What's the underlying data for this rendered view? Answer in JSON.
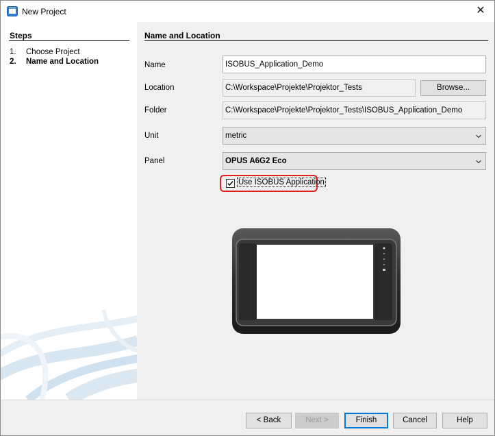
{
  "window": {
    "title": "New Project",
    "close_glyph": "✕"
  },
  "steps": {
    "title": "Steps",
    "items": [
      {
        "num": "1.",
        "label": "Choose Project"
      },
      {
        "num": "2.",
        "label": "Name and Location"
      }
    ]
  },
  "section_title": "Name and Location",
  "form": {
    "name_label": "Name",
    "name_value": "ISOBUS_Application_Demo",
    "location_label": "Location",
    "location_value": "C:\\Workspace\\Projekte\\Projektor_Tests",
    "browse_label": "Browse...",
    "folder_label": "Folder",
    "folder_value": "C:\\Workspace\\Projekte\\Projektor_Tests\\ISOBUS_Application_Demo",
    "unit_label": "Unit",
    "unit_value": "metric",
    "panel_label": "Panel",
    "panel_value": "OPUS A6G2 Eco",
    "checkbox_label": "Use ISOBUS Application",
    "checkbox_checked": true
  },
  "buttons": {
    "back": "< Back",
    "next": "Next >",
    "finish": "Finish",
    "cancel": "Cancel",
    "help": "Help"
  },
  "colors": {
    "highlight": "#e02020",
    "accent": "#0078d7"
  },
  "icons": [
    "app-window-icon",
    "close-icon",
    "chevron-down-icon",
    "check-icon",
    "device-image"
  ]
}
